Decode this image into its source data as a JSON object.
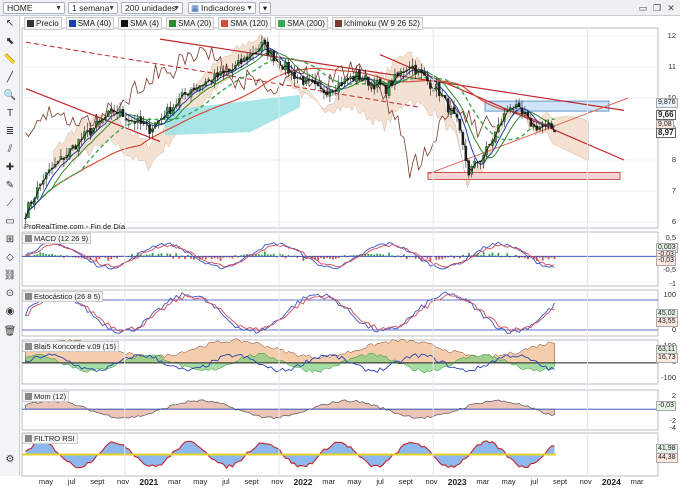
{
  "toolbar": {
    "ticker": "HOME",
    "timeframe": "1 semana",
    "units": "200 unidades",
    "indicators_label": "Indicadores"
  },
  "legend": [
    {
      "label": "Precio",
      "color": "#333333"
    },
    {
      "label": "SMA (40)",
      "color": "#1a3fb0"
    },
    {
      "label": "SMA (4)",
      "color": "#111111"
    },
    {
      "label": "SMA (20)",
      "color": "#2d8a2d"
    },
    {
      "label": "SMA (120)",
      "color": "#d44d3a"
    },
    {
      "label": "SMA (200)",
      "color": "#3aa850"
    },
    {
      "label": "Ichimoku (W 9 26 52)",
      "color": "#7a3b2b"
    }
  ],
  "source_label": "ProRealTime.com - Fin de Día",
  "price_axis": [
    "12",
    "11",
    "10",
    "9",
    "8",
    "7",
    "6"
  ],
  "price_tags": {
    "t1": "9,876",
    "t2": "9,66",
    "t3": "8,97",
    "t4": "9,08"
  },
  "panels": {
    "macd": {
      "title": "MACD (12 26 9)",
      "axis": [
        "0,5",
        "0",
        "-0,5",
        "-1"
      ],
      "tags": [
        "0,003",
        "-0,03",
        "-0,03"
      ]
    },
    "sto": {
      "title": "Estocástico (26 8 5)",
      "axis": [
        "100",
        "50",
        "0"
      ],
      "tags": [
        "45,02",
        "43,55"
      ]
    },
    "koncorde": {
      "title": "Blai5 Koncorde v.09 (15)",
      "axis": [
        "100",
        "0",
        "-100"
      ],
      "tags": [
        "63,11",
        "16,73"
      ]
    },
    "mom": {
      "title": "Mom (12)",
      "axis": [
        "2",
        "0",
        "-2",
        "-4"
      ],
      "tags": [
        "-0,03"
      ]
    },
    "rsi": {
      "title": "FILTRO RSI",
      "axis": [
        "",
        "",
        ""
      ],
      "tags": [
        "41,98",
        "44,38"
      ]
    }
  },
  "x_axis": [
    {
      "label": "may",
      "year": false
    },
    {
      "label": "jul",
      "year": false
    },
    {
      "label": "sept",
      "year": false
    },
    {
      "label": "nov",
      "year": false
    },
    {
      "label": "2021",
      "year": true
    },
    {
      "label": "mar",
      "year": false
    },
    {
      "label": "may",
      "year": false
    },
    {
      "label": "jul",
      "year": false
    },
    {
      "label": "sept",
      "year": false
    },
    {
      "label": "nov",
      "year": false
    },
    {
      "label": "2022",
      "year": true
    },
    {
      "label": "mar",
      "year": false
    },
    {
      "label": "may",
      "year": false
    },
    {
      "label": "jul",
      "year": false
    },
    {
      "label": "sept",
      "year": false
    },
    {
      "label": "nov",
      "year": false
    },
    {
      "label": "2023",
      "year": true
    },
    {
      "label": "mar",
      "year": false
    },
    {
      "label": "may",
      "year": false
    },
    {
      "label": "jul",
      "year": false
    },
    {
      "label": "sept",
      "year": false
    },
    {
      "label": "nov",
      "year": false
    },
    {
      "label": "2024",
      "year": true
    },
    {
      "label": "mar",
      "year": false
    }
  ],
  "colors": {
    "up": "#2e9b3a",
    "down": "#c0392b",
    "cloud": "#f1d9c6",
    "cloud_green": "#d8ebd0",
    "band": "#9ee3e6"
  }
}
